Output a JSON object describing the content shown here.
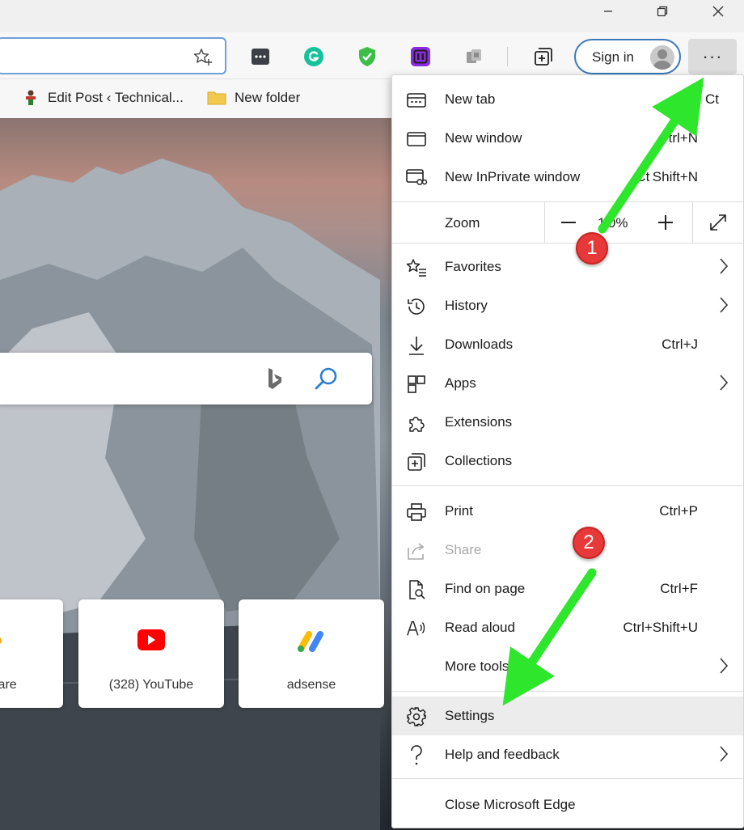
{
  "window": {
    "minimize_icon": "minimize-icon",
    "restore_icon": "restore-icon",
    "close_icon": "close-icon"
  },
  "toolbar": {
    "address_value": "",
    "favorite_icon": "star-plus-icon",
    "extensions": [
      "password-manager-icon",
      "grammarly-icon",
      "shield-extension-icon",
      "screen-capture-icon",
      "extension-puzzle-icon"
    ],
    "collections_icon": "collections-icon",
    "sign_in_label": "Sign in",
    "menu_label": "···"
  },
  "bookmarks": {
    "items": [
      {
        "label": "Edit Post ‹ Technical...",
        "icon": "wordpress-favicon"
      },
      {
        "label": "New folder",
        "icon": "folder-icon"
      }
    ]
  },
  "page": {
    "search_placeholder": "",
    "quick_links": [
      {
        "label": "lare",
        "icon": "cloudflare-icon"
      },
      {
        "label": "(328) YouTube",
        "icon": "youtube-icon"
      },
      {
        "label": "adsense",
        "icon": "adsense-icon"
      }
    ]
  },
  "menu": {
    "new_tab": {
      "label": "New tab",
      "shortcut": "Ct"
    },
    "new_window": {
      "label": "New window",
      "shortcut": "trl+N"
    },
    "new_inprivate": {
      "label": "New InPrivate window",
      "shortcut": "Ct Shift+N"
    },
    "zoom": {
      "label": "Zoom",
      "minus": "—",
      "value": "1 0%",
      "plus": "+"
    },
    "favorites": {
      "label": "Favorites"
    },
    "history": {
      "label": "History"
    },
    "downloads": {
      "label": "Downloads",
      "shortcut": "Ctrl+J"
    },
    "apps": {
      "label": "Apps"
    },
    "extensions": {
      "label": "Extensions"
    },
    "collections": {
      "label": "Collections"
    },
    "print": {
      "label": "Print",
      "shortcut": "Ctrl+P"
    },
    "share": {
      "label": "Share"
    },
    "find_on_page": {
      "label": "Find on page",
      "shortcut": "Ctrl+F"
    },
    "read_aloud": {
      "label": "Read aloud",
      "shortcut": "Ctrl+Shift+U"
    },
    "more_tools": {
      "label": "More tools"
    },
    "settings": {
      "label": "Settings"
    },
    "help_feedback": {
      "label": "Help and feedback"
    },
    "close_edge": {
      "label": "Close Microsoft Edge"
    }
  },
  "annotations": {
    "step1": "1",
    "step2": "2",
    "arrow_color": "#2ee62b",
    "badge_color": "#e8393a"
  }
}
